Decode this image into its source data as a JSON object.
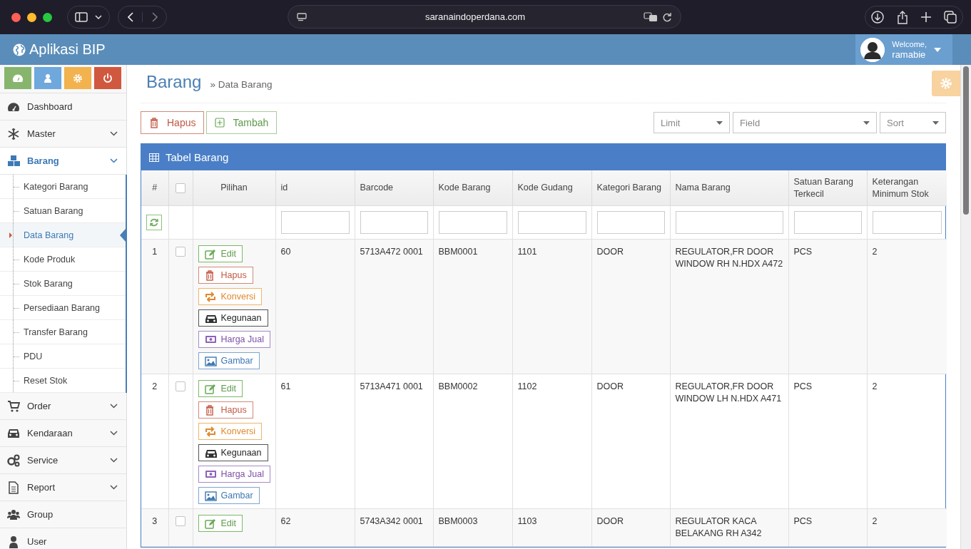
{
  "browser": {
    "url": "saranaindoperdana.com"
  },
  "app": {
    "title": "Aplikasi BIP",
    "user": {
      "greeting": "Welcome,",
      "name": "ramabie"
    }
  },
  "sidebar": {
    "items": [
      {
        "label": "Dashboard",
        "selected": false
      },
      {
        "label": "Master",
        "selected": false,
        "expanded": false
      },
      {
        "label": "Barang",
        "selected": true,
        "expanded": true,
        "children": [
          {
            "label": "Kategori Barang",
            "selected": false
          },
          {
            "label": "Satuan Barang",
            "selected": false
          },
          {
            "label": "Data Barang",
            "selected": true
          },
          {
            "label": "Kode Produk",
            "selected": false
          },
          {
            "label": "Stok Barang",
            "selected": false
          },
          {
            "label": "Persediaan Barang",
            "selected": false
          },
          {
            "label": "Transfer Barang",
            "selected": false
          },
          {
            "label": "PDU",
            "selected": false
          },
          {
            "label": "Reset Stok",
            "selected": false
          }
        ]
      },
      {
        "label": "Order",
        "selected": false,
        "expanded": false
      },
      {
        "label": "Kendaraan",
        "selected": false,
        "expanded": false
      },
      {
        "label": "Service",
        "selected": false,
        "expanded": false
      },
      {
        "label": "Report",
        "selected": false,
        "expanded": false
      },
      {
        "label": "Group",
        "selected": false
      },
      {
        "label": "User",
        "selected": false
      }
    ]
  },
  "page": {
    "title": "Barang",
    "breadcrumb": "» Data Barang",
    "toolbar": {
      "buttons": [
        {
          "label": "Hapus",
          "kind": "delete"
        },
        {
          "label": "Tambah",
          "kind": "add"
        }
      ],
      "selects": [
        {
          "placeholder": "Limit"
        },
        {
          "placeholder": "Field"
        },
        {
          "placeholder": "Sort"
        }
      ]
    },
    "table": {
      "title": "Tabel Barang",
      "columns": [
        {
          "kind": "text",
          "label": "#"
        },
        {
          "kind": "checkbox",
          "checked": false
        },
        {
          "kind": "text",
          "label": "Pilihan"
        },
        {
          "kind": "text",
          "label": "id"
        },
        {
          "kind": "text",
          "label": "Barcode"
        },
        {
          "kind": "text",
          "label": "Kode Barang"
        },
        {
          "kind": "text",
          "label": "Kode Gudang"
        },
        {
          "kind": "text",
          "label": "Kategori Barang"
        },
        {
          "kind": "text",
          "label": "Nama Barang"
        },
        {
          "kind": "text",
          "label": "Satuan Barang Terkecil"
        },
        {
          "kind": "text",
          "label": "Keterangan Minimum Stok"
        }
      ],
      "rows": [
        {
          "cells": [
            "1",
            {
              "kind": "checkbox",
              "checked": false
            },
            {
              "kind": "actions",
              "actions": [
                {
                  "label": "Edit",
                  "kind": "edit"
                },
                {
                  "label": "Hapus",
                  "kind": "delete"
                },
                {
                  "label": "Konversi",
                  "kind": "convert"
                },
                {
                  "label": "Kegunaan",
                  "kind": "usage"
                },
                {
                  "label": "Harga Jual",
                  "kind": "price"
                },
                {
                  "label": "Gambar",
                  "kind": "image"
                }
              ]
            },
            "60",
            "5713A472 0001",
            "BBM0001",
            "1101",
            "DOOR",
            "REGULATOR,FR DOOR WINDOW RH N.HDX A472",
            "PCS",
            "2"
          ]
        },
        {
          "cells": [
            "2",
            {
              "kind": "checkbox",
              "checked": false
            },
            {
              "kind": "actions",
              "actions": [
                {
                  "label": "Edit",
                  "kind": "edit"
                },
                {
                  "label": "Hapus",
                  "kind": "delete"
                },
                {
                  "label": "Konversi",
                  "kind": "convert"
                },
                {
                  "label": "Kegunaan",
                  "kind": "usage"
                },
                {
                  "label": "Harga Jual",
                  "kind": "price"
                },
                {
                  "label": "Gambar",
                  "kind": "image"
                }
              ]
            },
            "61",
            "5713A471 0001",
            "BBM0002",
            "1102",
            "DOOR",
            "REGULATOR,FR DOOR WINDOW LH N.HDX A471",
            "PCS",
            "2"
          ]
        },
        {
          "cells": [
            "3",
            {
              "kind": "checkbox",
              "checked": false
            },
            {
              "kind": "actions",
              "actions": [
                {
                  "label": "Edit",
                  "kind": "edit"
                }
              ]
            },
            "62",
            "5743A342 0001",
            "BBM0003",
            "1103",
            "DOOR",
            "REGULATOR KACA BELAKANG RH A342",
            "PCS",
            "2"
          ]
        }
      ]
    }
  }
}
